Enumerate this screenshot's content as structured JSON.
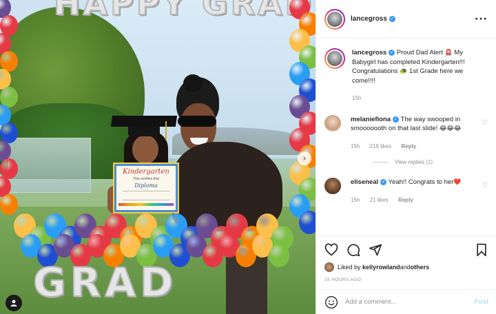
{
  "post": {
    "username": "lancegross",
    "more_icon": "more-horizontal-icon"
  },
  "photo": {
    "certificate": {
      "title": "Kindergarten",
      "subtitle": "This certifies that",
      "name": "Diploma"
    },
    "foil_top": "HAPPY GRAD",
    "foil_bottom": "GRAD"
  },
  "caption": {
    "username": "lancegross",
    "text_1": " Proud Dad Alert ",
    "emoji_1": "🚨",
    "text_2": " My Babygirl has completed Kindergarten!!! Congratulations ",
    "emoji_2": "🐢",
    "text_3": " 1st Grade here we come!!!!",
    "time": "15h"
  },
  "comments": [
    {
      "username": "melaniefiona",
      "text_1": " The way swooped in smooooooth on that last slide! ",
      "emojis": "😂😂😂",
      "time": "15h",
      "likes": "219 likes",
      "reply": "Reply",
      "view_replies": "View replies (1)"
    },
    {
      "username": "eliseneal",
      "text_1": " Yeah!! Congrats to her",
      "emojis": "❤️",
      "time": "15h",
      "likes": "21 likes",
      "reply": "Reply"
    }
  ],
  "actions": {
    "liked_prefix": "Liked by ",
    "liked_user": "kellyrowland",
    "liked_and": " and ",
    "liked_others": "others",
    "timestamp": "15 HOURS AGO"
  },
  "add_comment": {
    "placeholder": "Add a comment...",
    "post_label": "Post"
  },
  "colors": {
    "verified": "#3897f0",
    "muted": "#8e8e8e",
    "post_disabled": "#b2dffc",
    "heart_red": "#ed4956"
  }
}
